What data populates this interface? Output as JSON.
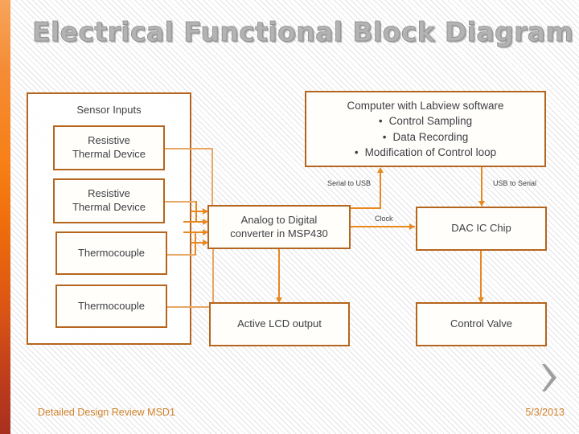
{
  "slide": {
    "title": "Electrical Functional Block Diagram",
    "background_color": "#ffffff",
    "accent_color": "#b5651d",
    "connector_color": "#e8891f",
    "text_color": "#3f4044"
  },
  "sidebar": {
    "gradient_top": "#f7a45c",
    "gradient_bottom": "#a8301f"
  },
  "diagram": {
    "sensor_group": {
      "title": "Sensor Inputs",
      "sensors": [
        {
          "label": "Resistive\nThermal Device",
          "line1": "Resistive",
          "line2": "Thermal Device"
        },
        {
          "label": "Resistive\nThermal Device",
          "line1": "Resistive",
          "line2": "Thermal Device"
        },
        {
          "label": "Thermocouple",
          "line1": "Thermocouple",
          "line2": ""
        },
        {
          "label": "Thermocouple",
          "line1": "Thermocouple",
          "line2": ""
        }
      ]
    },
    "adc": {
      "line1": "Analog to Digital",
      "line2": "converter in MSP430"
    },
    "computer": {
      "headline": "Computer with Labview software",
      "bullets": [
        "Control Sampling",
        "Data Recording",
        "Modification of Control loop"
      ],
      "bullet_glyph": "•"
    },
    "dac": {
      "label": "DAC IC Chip"
    },
    "lcd": {
      "label": "Active LCD output"
    },
    "valve": {
      "label": "Control Valve"
    },
    "edge_labels": {
      "serial_to_usb": "Serial to USB",
      "usb_to_serial": "USB to Serial",
      "clock": "Clock"
    }
  },
  "footer": {
    "left": "Detailed Design Review MSD1",
    "right": "5/3/2013",
    "chevron_icon": "chevron-right-icon",
    "color": "#d1822b"
  }
}
